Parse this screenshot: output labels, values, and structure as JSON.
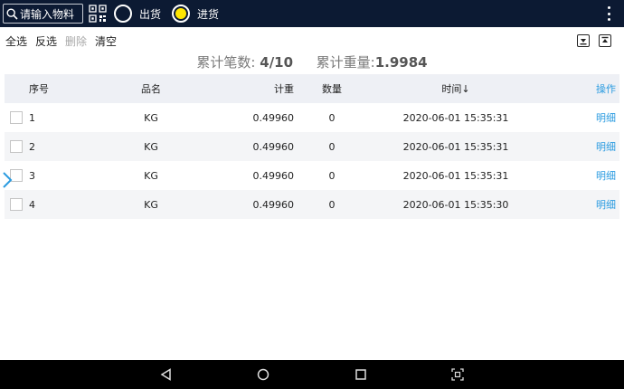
{
  "topbar": {
    "search_placeholder": "请输入物料",
    "radio_out_label": "出货",
    "radio_in_label": "进货",
    "selected": "进货"
  },
  "actions": {
    "select_all": "全选",
    "invert": "反选",
    "delete": "删除",
    "clear": "清空"
  },
  "summary": {
    "count_label": "累计笔数:",
    "count_value": "4/10",
    "weight_label": "累计重量:",
    "weight_value": "1.9984"
  },
  "table": {
    "headers": {
      "index": "序号",
      "name": "品名",
      "weight": "计重",
      "qty": "数量",
      "time": "时间↓",
      "op": "操作"
    },
    "rows": [
      {
        "index": "1",
        "name": "KG",
        "weight": "0.49960",
        "qty": "0",
        "time": "2020-06-01 15:35:31",
        "op": "明细"
      },
      {
        "index": "2",
        "name": "KG",
        "weight": "0.49960",
        "qty": "0",
        "time": "2020-06-01 15:35:31",
        "op": "明细"
      },
      {
        "index": "3",
        "name": "KG",
        "weight": "0.49960",
        "qty": "0",
        "time": "2020-06-01 15:35:31",
        "op": "明细"
      },
      {
        "index": "4",
        "name": "KG",
        "weight": "0.49960",
        "qty": "0",
        "time": "2020-06-01 15:35:30",
        "op": "明细"
      }
    ]
  },
  "colors": {
    "topbar_bg": "#0c1a33",
    "accent_link": "#2a9be0",
    "radio_selected": "#ffe600"
  },
  "icons": [
    "search-icon",
    "qr-scan-icon",
    "more-vert-icon",
    "import-icon",
    "export-icon",
    "chevron-right-icon",
    "nav-back-icon",
    "nav-home-icon",
    "nav-recents-icon",
    "screenshot-icon"
  ]
}
